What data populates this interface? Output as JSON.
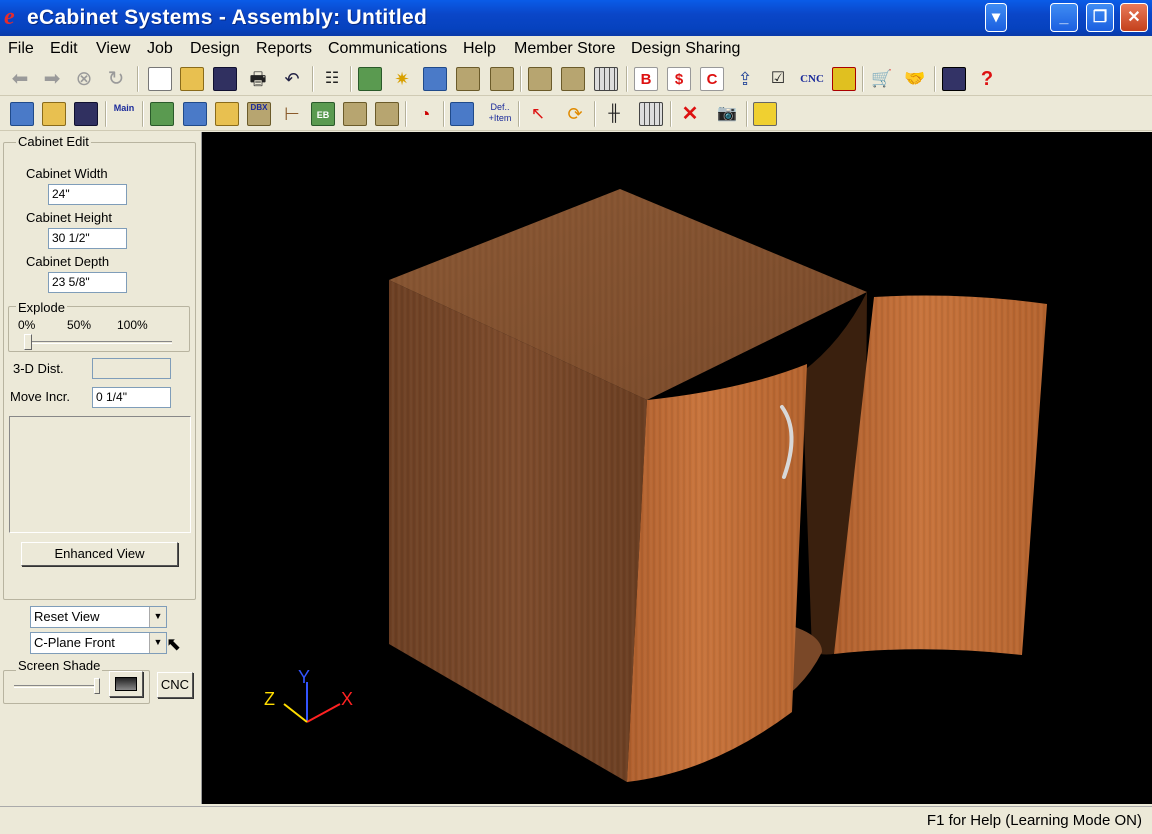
{
  "window": {
    "title": "eCabinet Systems - Assembly: Untitled",
    "logo": "e"
  },
  "menu": [
    "File",
    "Edit",
    "View",
    "Job",
    "Design",
    "Reports",
    "Communications",
    "Help",
    "Member Store",
    "Design Sharing"
  ],
  "toolbar1": {
    "cnc_label": "CNC",
    "b_label": "B",
    "c_label": "C",
    "help_label": "?"
  },
  "toolbar2": {
    "main_label": "Main",
    "dbx_label": "DBX",
    "eb_label": "EB",
    "def_label": "Def..",
    "item_label": "+Item"
  },
  "panel": {
    "cabinet_edit_label": "Cabinet Edit",
    "width_label": "Cabinet Width",
    "width_value": "24\"",
    "height_label": "Cabinet Height",
    "height_value": "30 1/2\"",
    "depth_label": "Cabinet Depth",
    "depth_value": "23 5/8\"",
    "explode_label": "Explode",
    "explode_ticks": [
      "0%",
      "50%",
      "100%"
    ],
    "explode_level_percent": 0,
    "dist_label": "3-D Dist.",
    "dist_value": "",
    "incr_label": "Move Incr.",
    "incr_value": "0 1/4\"",
    "enhanced_view_label": "Enhanced View",
    "reset_view_value": "Reset View",
    "cplane_value": "C-Plane Front",
    "screen_shade_label": "Screen Shade",
    "screen_shade_level_percent": 100,
    "cnc_button_label": "CNC"
  },
  "axes": {
    "x": "X",
    "y": "Y",
    "z": "Z"
  },
  "colors": {
    "wood_dark": "#7a4a2a",
    "wood_light": "#c4703a",
    "viewport_bg": "#000000"
  },
  "status": {
    "text": "F1 for Help (Learning Mode ON)"
  }
}
